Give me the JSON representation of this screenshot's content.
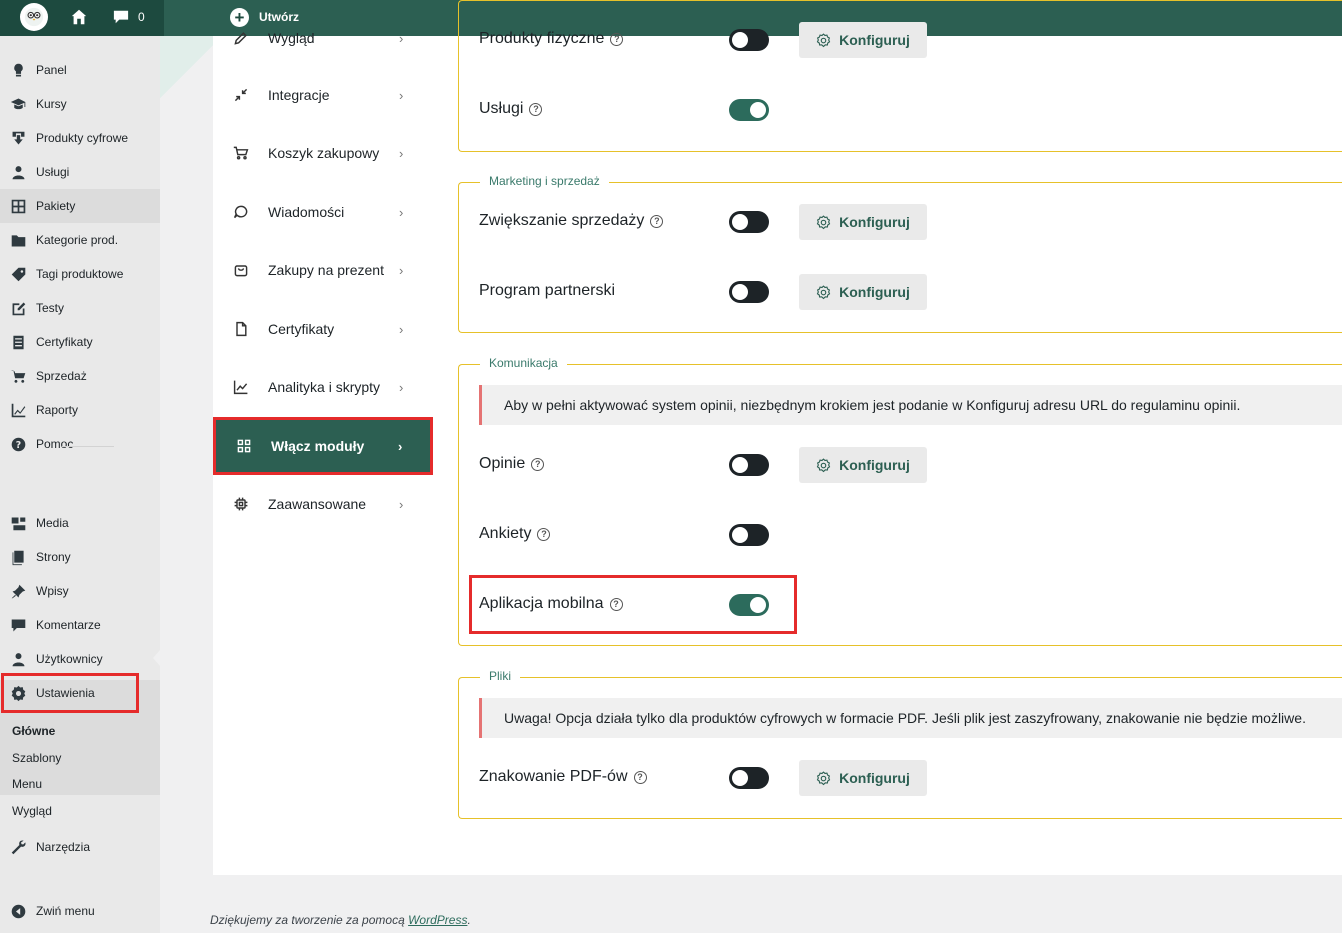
{
  "topbar": {
    "comments_count": "0",
    "create_label": "Utwórz"
  },
  "wp_menu": [
    {
      "label": "Panel",
      "icon": "lightbulb-icon"
    },
    {
      "label": "Kursy",
      "icon": "graduation-cap-icon"
    },
    {
      "label": "Produkty cyfrowe",
      "icon": "download-icon"
    },
    {
      "label": "Usługi",
      "icon": "person-icon"
    },
    {
      "label": "Pakiety",
      "icon": "grid-icon"
    },
    {
      "label": "Kategorie prod.",
      "icon": "folder-icon"
    },
    {
      "label": "Tagi produktowe",
      "icon": "tag-icon"
    },
    {
      "label": "Testy",
      "icon": "edit-icon"
    },
    {
      "label": "Certyfikaty",
      "icon": "document-icon"
    },
    {
      "label": "Sprzedaż",
      "icon": "cart-icon"
    },
    {
      "label": "Raporty",
      "icon": "chart-icon"
    },
    {
      "label": "Pomoc",
      "icon": "help-icon"
    },
    {
      "label": "Media",
      "icon": "media-icon"
    },
    {
      "label": "Strony",
      "icon": "pages-icon"
    },
    {
      "label": "Wpisy",
      "icon": "pin-icon"
    },
    {
      "label": "Komentarze",
      "icon": "comment-icon"
    },
    {
      "label": "Użytkownicy",
      "icon": "users-icon"
    },
    {
      "label": "Ustawienia",
      "icon": "gear-icon"
    },
    {
      "label": "Narzędzia",
      "icon": "wrench-icon"
    },
    {
      "label": "Zwiń menu",
      "icon": "collapse-icon"
    }
  ],
  "settings_submenu": [
    "Główne",
    "Szablony",
    "Menu",
    "Wygląd"
  ],
  "settings_nav": [
    {
      "label": "Wygląd",
      "icon": "pen-icon"
    },
    {
      "label": "Integracje",
      "icon": "integration-icon"
    },
    {
      "label": "Koszyk zakupowy",
      "icon": "cart-icon"
    },
    {
      "label": "Wiadomości",
      "icon": "message-icon"
    },
    {
      "label": "Zakupy na prezent",
      "icon": "gift-icon"
    },
    {
      "label": "Certyfikaty",
      "icon": "file-icon"
    },
    {
      "label": "Analityka i skrypty",
      "icon": "analytics-icon"
    },
    {
      "label": "Włącz moduły",
      "icon": "modules-icon"
    },
    {
      "label": "Zaawansowane",
      "icon": "chip-icon"
    }
  ],
  "modules": {
    "top_rows": [
      {
        "label": "Produkty fizyczne",
        "on": false,
        "configurable": true
      },
      {
        "label": "Usługi",
        "on": true,
        "configurable": false
      }
    ],
    "marketing": {
      "legend": "Marketing i sprzedaż",
      "rows": [
        {
          "label": "Zwiększanie sprzedaży",
          "help": true,
          "on": false
        },
        {
          "label": "Program partnerski",
          "help": false,
          "on": false
        }
      ]
    },
    "komunikacja": {
      "legend": "Komunikacja",
      "notice": "Aby w pełni aktywować system opinii, niezbędnym krokiem jest podanie w Konfiguruj adresu URL do regulaminu opinii.",
      "rows": [
        {
          "label": "Opinie",
          "on": false
        },
        {
          "label": "Ankiety",
          "on": false
        },
        {
          "label": "Aplikacja mobilna",
          "on": true
        }
      ]
    },
    "pliki": {
      "legend": "Pliki",
      "notice": "Uwaga! Opcja działa tylko dla produktów cyfrowych w formacie PDF. Jeśli plik jest zaszyfrowany, znakowanie nie będzie możliwe.",
      "rows": [
        {
          "label": "Znakowanie PDF-ów",
          "on": false
        }
      ]
    },
    "configure_label": "Konfiguruj"
  },
  "footer": {
    "text": "Dziękujemy za tworzenie za pomocą ",
    "link": "WordPress",
    "end": "."
  },
  "colors": {
    "brand": "#2c5f52",
    "toggle_on": "#2c6b5c",
    "fieldset_border": "#e6c12a",
    "highlight": "#e52b2b"
  }
}
